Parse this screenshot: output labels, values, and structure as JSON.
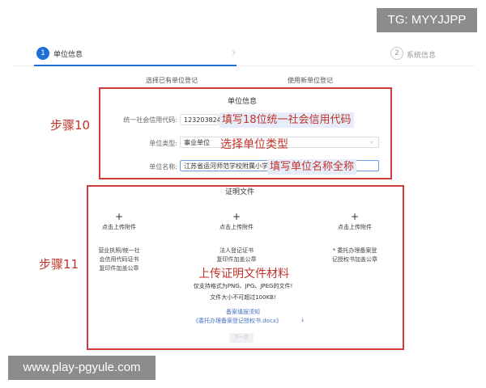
{
  "watermarks": {
    "top_right": "TG: MYYJJPP",
    "bottom_left": "www.play-pgyule.com"
  },
  "steps": [
    {
      "number": "1",
      "label": "单位信息",
      "state": "active"
    },
    {
      "number": "2",
      "label": "系统信息",
      "state": "inactive"
    }
  ],
  "tabs": {
    "select_existing": "选择已有单位登记",
    "use_new": "使用新单位登记"
  },
  "unit_info": {
    "section_title": "单位信息",
    "credit_code": {
      "label": "统一社会信用代码:",
      "value": "12320382466656431T"
    },
    "unit_type": {
      "label": "单位类型:",
      "value": "事业单位"
    },
    "unit_name": {
      "label": "单位名称:",
      "value": "江苏省运河师范学校附属小学"
    }
  },
  "annotations": {
    "step10": "步骤10",
    "step11": "步骤11",
    "credit_code_hint": "填写18位统一社会信用代码",
    "unit_type_hint": "选择单位类型",
    "unit_name_hint": "填写单位名称全称",
    "upload_hint": "上传证明文件材料"
  },
  "proof_files": {
    "section_title": "证明文件",
    "uploads": [
      {
        "plus": "+",
        "label": "点击上传附件",
        "desc_lines": [
          "营业执照/统一社",
          "会信用代码证书",
          "复印件加盖公章"
        ]
      },
      {
        "plus": "+",
        "label": "点击上传附件",
        "desc_lines": [
          "法人登记证书",
          "复印件加盖公章"
        ]
      },
      {
        "plus": "+",
        "label": "点击上传附件",
        "desc_lines": [
          "* 委托办理备案登",
          "记授权书加盖公章"
        ]
      }
    ],
    "format_note": "仅支持格式为PNG、JPG、JPEG的文件!",
    "size_note": "文件大小不可超过100KB!",
    "guide_link": "备案填报须知",
    "template_link": "《委托办理备案登记授权书.docx》",
    "download_icon": "download-icon"
  },
  "next_button": "下一步"
}
